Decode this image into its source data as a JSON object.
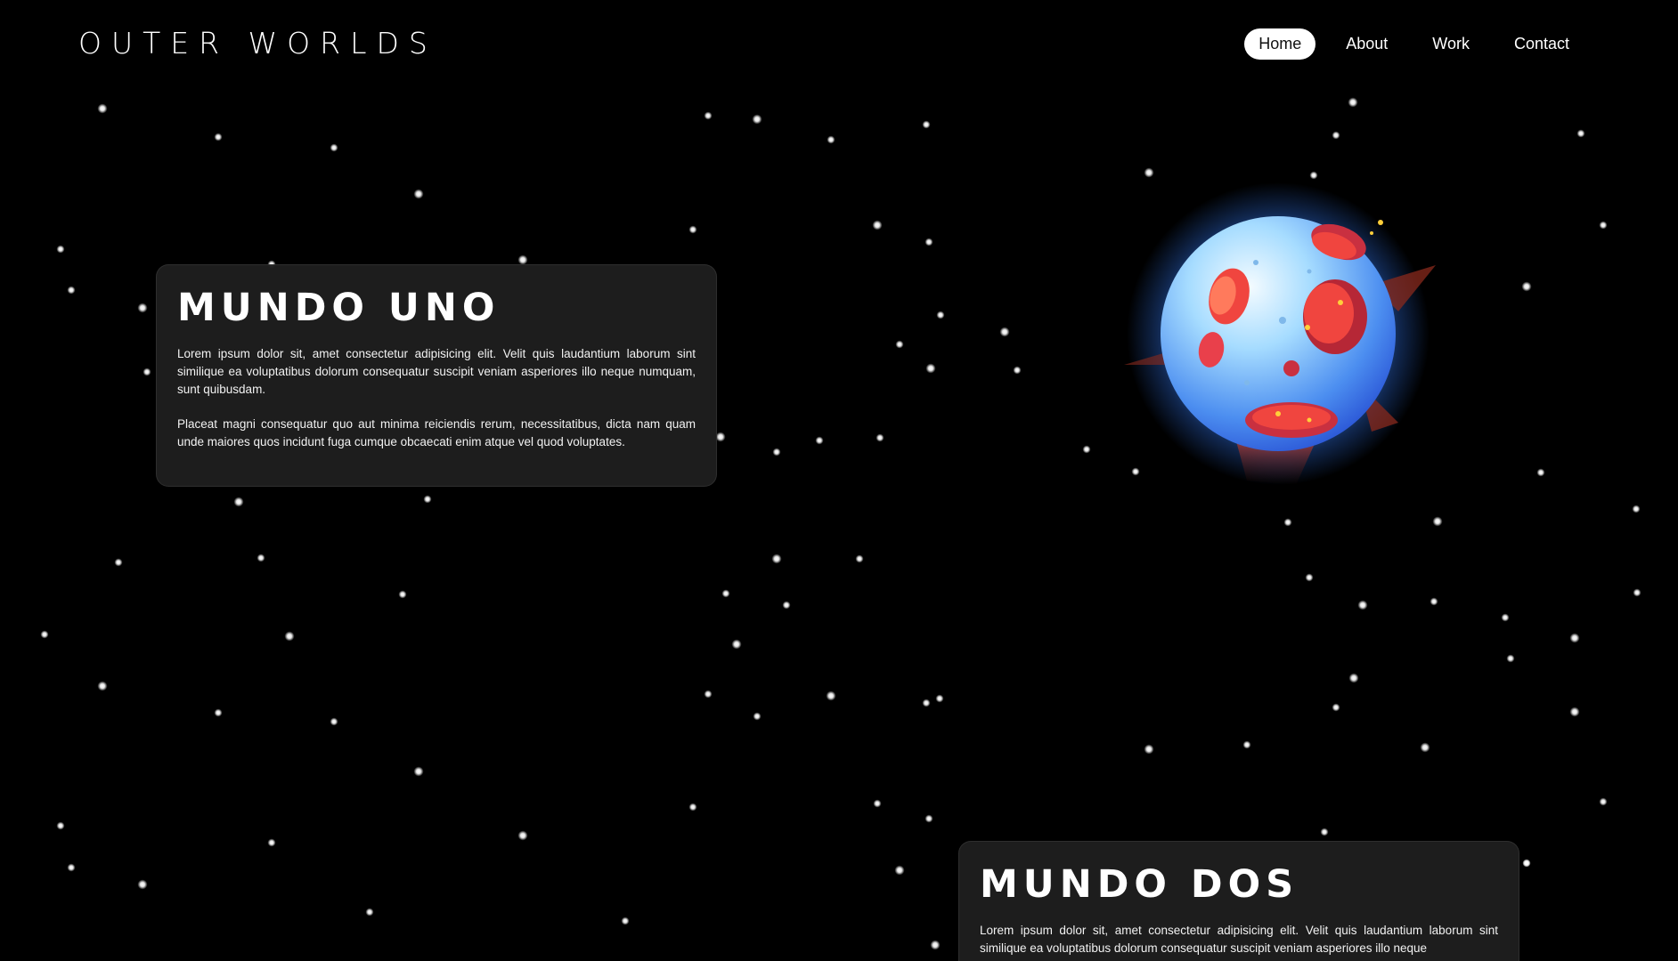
{
  "header": {
    "logo": "OUTER WORLDS",
    "nav": [
      {
        "label": "Home",
        "active": true
      },
      {
        "label": "About",
        "active": false
      },
      {
        "label": "Work",
        "active": false
      },
      {
        "label": "Contact",
        "active": false
      }
    ]
  },
  "sections": [
    {
      "title": "MUNDO UNO",
      "paragraphs": [
        "Lorem ipsum dolor sit, amet consectetur adipisicing elit. Velit quis laudantium laborum sint similique ea voluptatibus dolorum consequatur suscipit veniam asperiores illo neque numquam, sunt quibusdam.",
        "Placeat magni consequatur quo aut minima reiciendis rerum, necessitatibus, dicta nam quam unde maiores quos incidunt fuga cumque obcaecati enim atque vel quod voluptates."
      ]
    },
    {
      "title": "MUNDO DOS",
      "paragraphs": [
        "Lorem ipsum dolor sit, amet consectetur adipisicing elit. Velit quis laudantium laborum sint similique ea voluptatibus dolorum consequatur suscipit veniam asperiores illo neque"
      ]
    }
  ],
  "illustration": {
    "icon": "planet-icon",
    "colors": {
      "planet_light": "#e8f7ff",
      "planet_mid": "#7ecbff",
      "planet_dark": "#2f6fe0",
      "crater": "#f0453f",
      "crater_dark": "#b62736",
      "glow": "#3f8dff"
    }
  },
  "colors": {
    "background": "#000000",
    "card": "#1e1e1e",
    "star": "#ffffff",
    "active_nav_bg": "#ffffff",
    "active_nav_text": "#111111"
  }
}
